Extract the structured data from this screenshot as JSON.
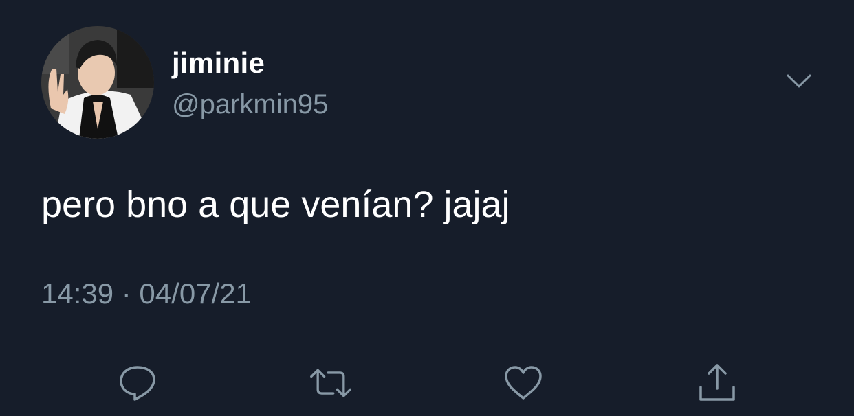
{
  "tweet": {
    "display_name": "jiminie",
    "handle": "@parkmin95",
    "text": "pero bno a que venían? jajaj",
    "timestamp": "14:39 · 04/07/21"
  },
  "icons": {
    "avatar": "user-avatar-photo",
    "more": "chevron-down-icon",
    "reply": "reply-icon",
    "retweet": "retweet-icon",
    "like": "heart-icon",
    "share": "share-icon"
  },
  "colors": {
    "background": "#161d2a",
    "primary_text": "#ffffff",
    "secondary_text": "#8899a6",
    "divider": "#38444d"
  }
}
